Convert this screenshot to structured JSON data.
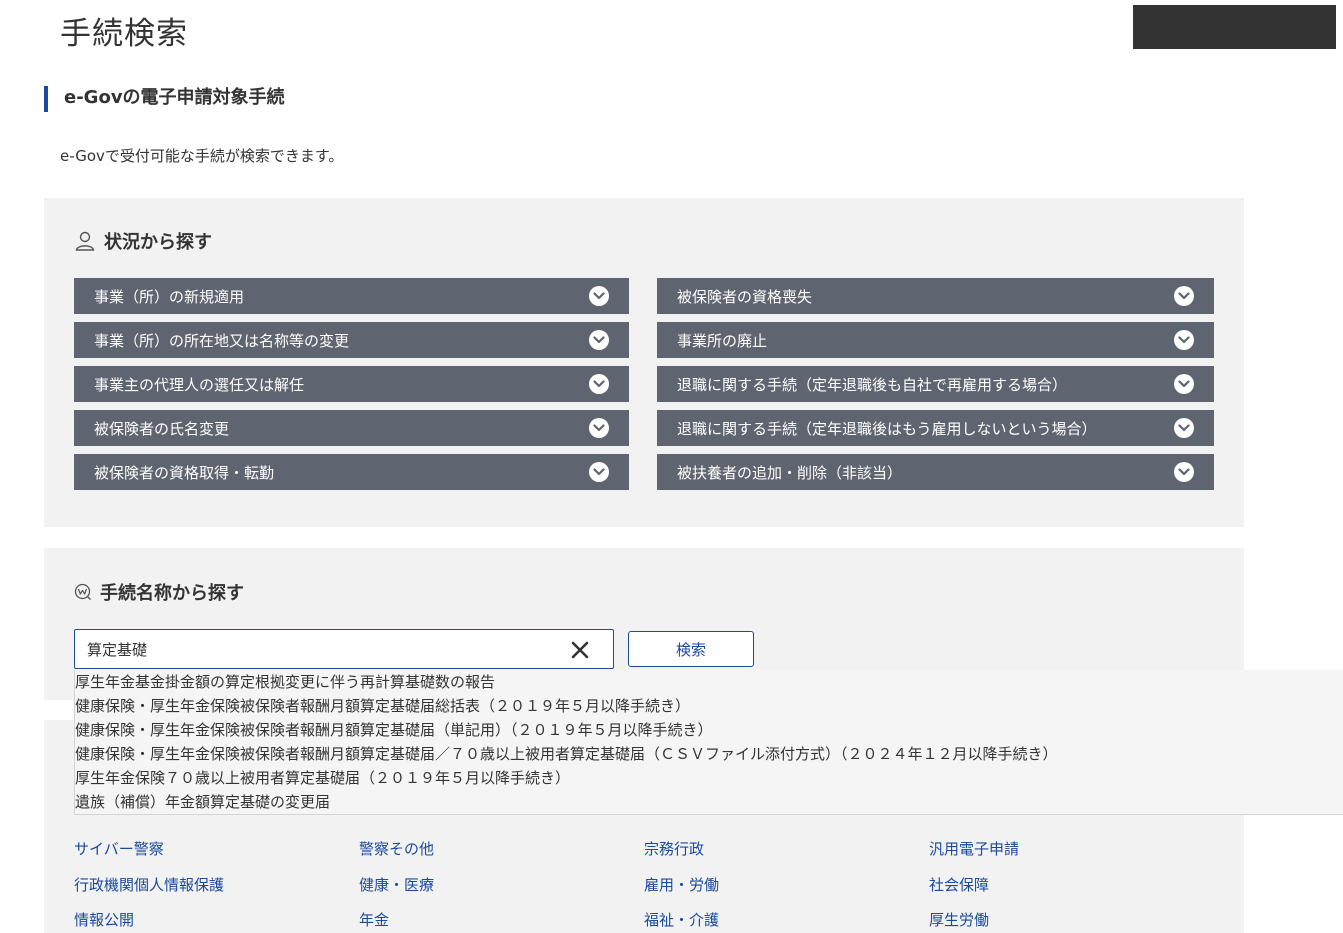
{
  "page": {
    "title": "手続検索",
    "section_heading": "e-Govの電子申請対象手続",
    "intro": "e-Govで受付可能な手続が検索できます。"
  },
  "situation": {
    "title": "状況から探す",
    "title_icon": "person-icon",
    "left": [
      "事業（所）の新規適用",
      "事業（所）の所在地又は名称等の変更",
      "事業主の代理人の選任又は解任",
      "被保険者の氏名変更",
      "被保険者の資格取得・転勤"
    ],
    "right": [
      "被保険者の資格喪失",
      "事業所の廃止",
      "退職に関する手続（定年退職後も自社で再雇用する場合）",
      "退職に関する手続（定年退職後はもう雇用しないという場合）",
      "被扶養者の追加・削除（非該当）"
    ]
  },
  "name_search": {
    "title": "手続名称から探す",
    "title_icon": "search-w-icon",
    "input_value": "算定基礎",
    "button_label": "検索"
  },
  "suggestions": [
    "厚生年金基金掛金額の算定根拠変更に伴う再計算基礎数の報告",
    "健康保険・厚生年金保険被保険者報酬月額算定基礎届総括表（２０１９年５月以降手続き）",
    "健康保険・厚生年金保険被保険者報酬月額算定基礎届（単記用）（２０１９年５月以降手続き）",
    "健康保険・厚生年金保険被保険者報酬月額算定基礎届／７０歳以上被用者算定基礎届（ＣＳＶファイル添付方式）（２０２４年１２月以降手続き）",
    "厚生年金保険７０歳以上被用者算定基礎届（２０１９年５月以降手続き）",
    "遺族（補償）年金額算定基礎の変更届"
  ],
  "categories": [
    [
      "サイバー警察",
      "警察その他",
      "宗務行政",
      "汎用電子申請"
    ],
    [
      "行政機関個人情報保護",
      "健康・医療",
      "雇用・労働",
      "社会保障"
    ],
    [
      "情報公開",
      "年金",
      "福祉・介護",
      "厚生労働"
    ]
  ],
  "colors": {
    "accent": "#1a4a9c",
    "accordion": "#5f6570",
    "panel": "#f2f2f2"
  }
}
